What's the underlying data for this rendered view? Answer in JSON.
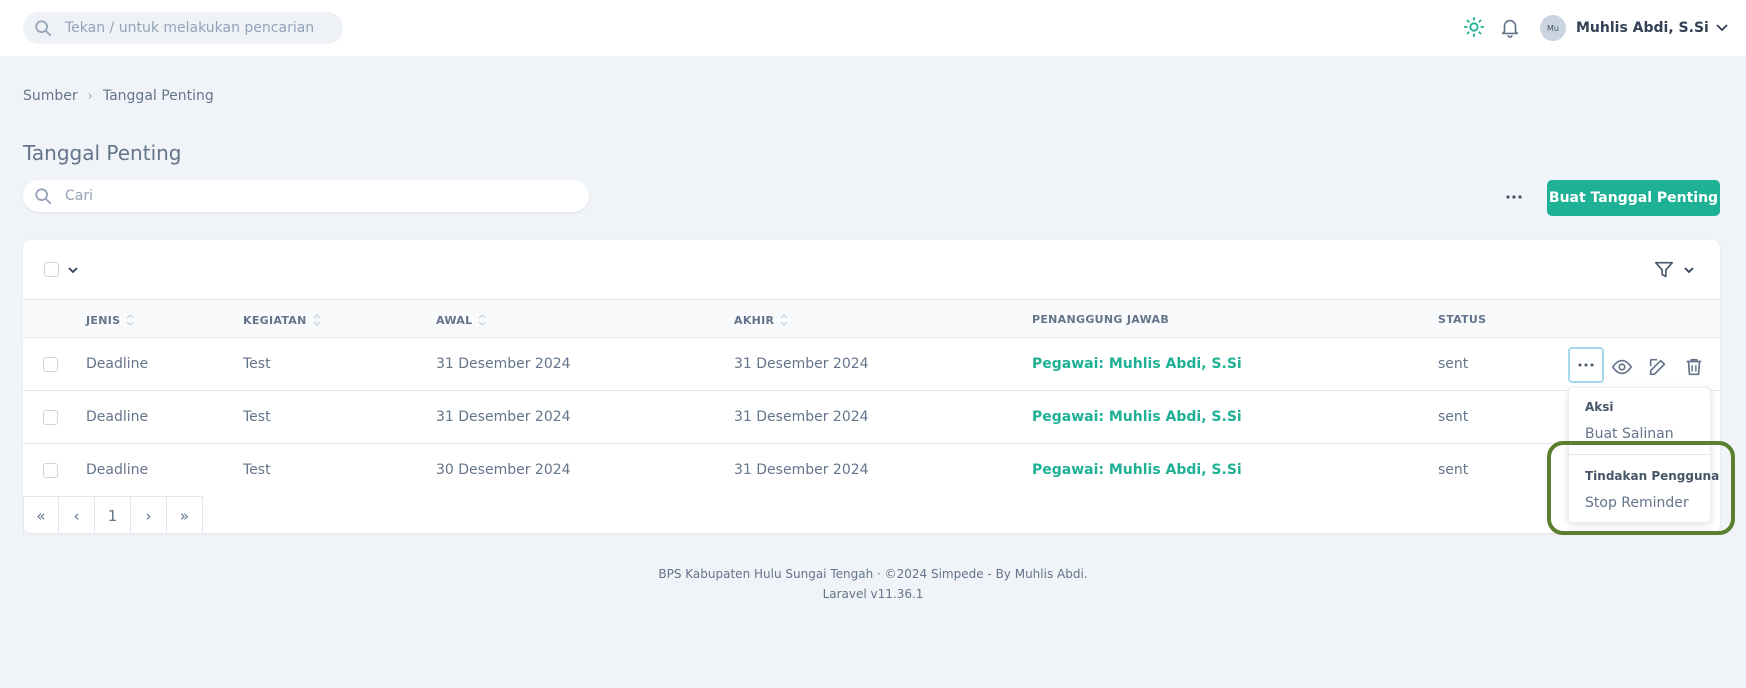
{
  "topbar": {
    "search_placeholder": "Tekan / untuk melakukan pencarian",
    "user_name": "Muhlis Abdi, S.Si",
    "avatar_alt": "Mu",
    "accent_color": "#1fb195"
  },
  "breadcrumb": [
    "Sumber",
    "Tanggal Penting"
  ],
  "page_title": "Tanggal Penting",
  "search_placeholder": "Cari",
  "create_button": "Buat Tanggal Penting",
  "table": {
    "columns": [
      "JENIS",
      "KEGIATAN",
      "AWAL",
      "AKHIR",
      "PENANGGUNG JAWAB",
      "STATUS"
    ],
    "rows": [
      {
        "jenis": "Deadline",
        "kegiatan": "Test",
        "awal": "31 Desember 2024",
        "akhir": "31 Desember 2024",
        "penanggung_jawab": "Pegawai: Muhlis Abdi, S.Si",
        "status": "sent"
      },
      {
        "jenis": "Deadline",
        "kegiatan": "Test",
        "awal": "31 Desember 2024",
        "akhir": "31 Desember 2024",
        "penanggung_jawab": "Pegawai: Muhlis Abdi, S.Si",
        "status": "sent"
      },
      {
        "jenis": "Deadline",
        "kegiatan": "Test",
        "awal": "30 Desember 2024",
        "akhir": "31 Desember 2024",
        "penanggung_jawab": "Pegawai: Muhlis Abdi, S.Si",
        "status": "sent"
      }
    ]
  },
  "pagination": {
    "first": "«",
    "prev": "‹",
    "page": "1",
    "next": "›",
    "last": "»"
  },
  "dropdown": {
    "section1": "Aksi",
    "item1": "Buat Salinan",
    "section2": "Tindakan Pengguna",
    "item2": "Stop Reminder"
  },
  "footer": {
    "line1": "BPS Kabupaten Hulu Sungai Tengah  ·  ©2024 Simpede - By Muhlis Abdi.",
    "line2": "Laravel v11.36.1"
  }
}
